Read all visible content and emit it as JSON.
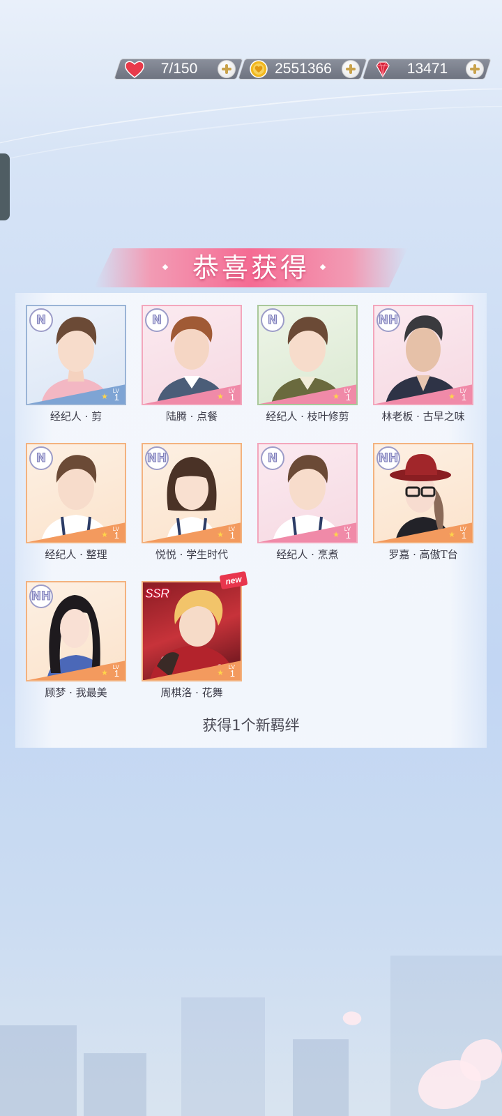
{
  "resources": [
    {
      "name": "stamina",
      "icon": "heart-icon",
      "value": "7/150"
    },
    {
      "name": "coins",
      "icon": "gold-coin-icon",
      "value": "2551366"
    },
    {
      "name": "diamonds",
      "icon": "red-diamond-icon",
      "value": "13471"
    }
  ],
  "title": "恭喜获得",
  "cards": [
    {
      "rarity": "N",
      "name": "经纪人 · 剪",
      "level": "1",
      "lv_label": "LV"
    },
    {
      "rarity": "N",
      "name": "陆腾 · 点餐",
      "level": "1",
      "lv_label": "LV"
    },
    {
      "rarity": "N",
      "name": "经纪人 · 枝叶修剪",
      "level": "1",
      "lv_label": "LV"
    },
    {
      "rarity": "NH",
      "name": "林老板 · 古早之味",
      "level": "1",
      "lv_label": "LV"
    },
    {
      "rarity": "N",
      "name": "经纪人 · 整理",
      "level": "1",
      "lv_label": "LV"
    },
    {
      "rarity": "NH",
      "name": "悦悦 · 学生时代",
      "level": "1",
      "lv_label": "LV"
    },
    {
      "rarity": "N",
      "name": "经纪人 · 烹煮",
      "level": "1",
      "lv_label": "LV"
    },
    {
      "rarity": "NH",
      "name": "罗嘉 · 高傲T台",
      "level": "1",
      "lv_label": "LV"
    },
    {
      "rarity": "NH",
      "name": "顾梦 · 我最美",
      "level": "1",
      "lv_label": "LV"
    },
    {
      "rarity": "SSR",
      "name": "周棋洛 · 花舞",
      "level": "1",
      "lv_label": "LV",
      "tag": "new"
    }
  ],
  "footer": "获得1个新羁绊",
  "colors": {
    "banner": "#f56b93",
    "frame_blue": "#9ab4d6",
    "frame_pink": "#f3a6bc",
    "frame_green": "#a9c89a",
    "frame_orange": "#f3b27f"
  }
}
